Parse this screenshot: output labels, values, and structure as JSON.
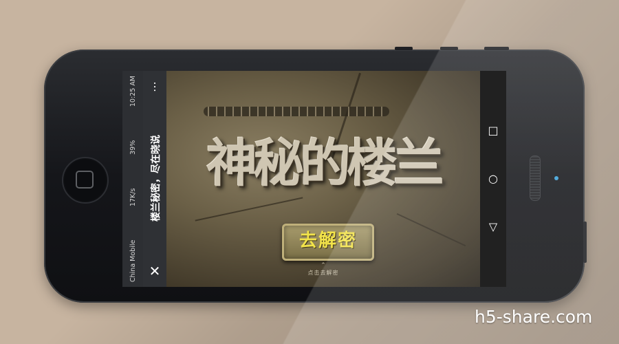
{
  "status_bar": {
    "carrier": "China Mobile",
    "network_speed": "17K/s",
    "battery": "39%",
    "time": "10:25 AM"
  },
  "title_bar": {
    "title": "楼兰秘密，尽在晓说",
    "close_icon": "close-icon",
    "more_icon": "more-vertical-icon"
  },
  "content": {
    "headline": "神秘的楼兰",
    "decode_button_label": "去解密",
    "hint_arrow": "⌃",
    "hint_text": "点击去解密"
  },
  "nav_bar": {
    "recent_icon": "recent-apps-icon",
    "home_icon": "home-icon",
    "back_icon": "back-icon"
  },
  "watermark": "h5-share.com",
  "colors": {
    "background": "#c7b4a0",
    "decode_text": "#f2e34a",
    "statusbar": "#2d2f33"
  }
}
